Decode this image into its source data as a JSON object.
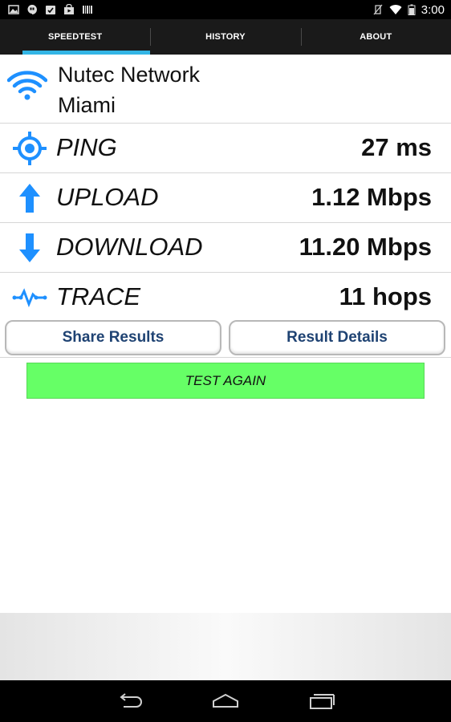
{
  "status_bar": {
    "time": "3:00",
    "left_icons": [
      "picture-icon",
      "hangouts-icon",
      "calendar-check-icon",
      "shopping-bag-icon",
      "barcode-icon"
    ],
    "right_icons": [
      "vibrate-off-icon",
      "wifi-signal-icon",
      "battery-icon"
    ]
  },
  "tabs": [
    {
      "label": "SPEEDTEST",
      "active": true
    },
    {
      "label": "HISTORY",
      "active": false
    },
    {
      "label": "ABOUT",
      "active": false
    }
  ],
  "network": {
    "icon": "wifi-icon",
    "name": "Nutec Network",
    "city": "Miami"
  },
  "metrics": [
    {
      "label": "PING",
      "value": "27 ms",
      "icon": "target-icon"
    },
    {
      "label": "UPLOAD",
      "value": "1.12 Mbps",
      "icon": "upload-arrow-icon"
    },
    {
      "label": "DOWNLOAD",
      "value": "11.20 Mbps",
      "icon": "download-arrow-icon"
    },
    {
      "label": "TRACE",
      "value": "11 hops",
      "icon": "trace-wave-icon"
    }
  ],
  "actions": {
    "share_label": "Share Results",
    "details_label": "Result Details"
  },
  "test_again_label": "TEST AGAIN",
  "colors": {
    "accent": "#33b5e5",
    "icon_blue": "#1e90ff",
    "button_text": "#1f4373",
    "test_again_bg": "#66ff66"
  },
  "nav_bar": {
    "icons": [
      "back-icon",
      "home-icon",
      "recent-apps-icon"
    ]
  }
}
